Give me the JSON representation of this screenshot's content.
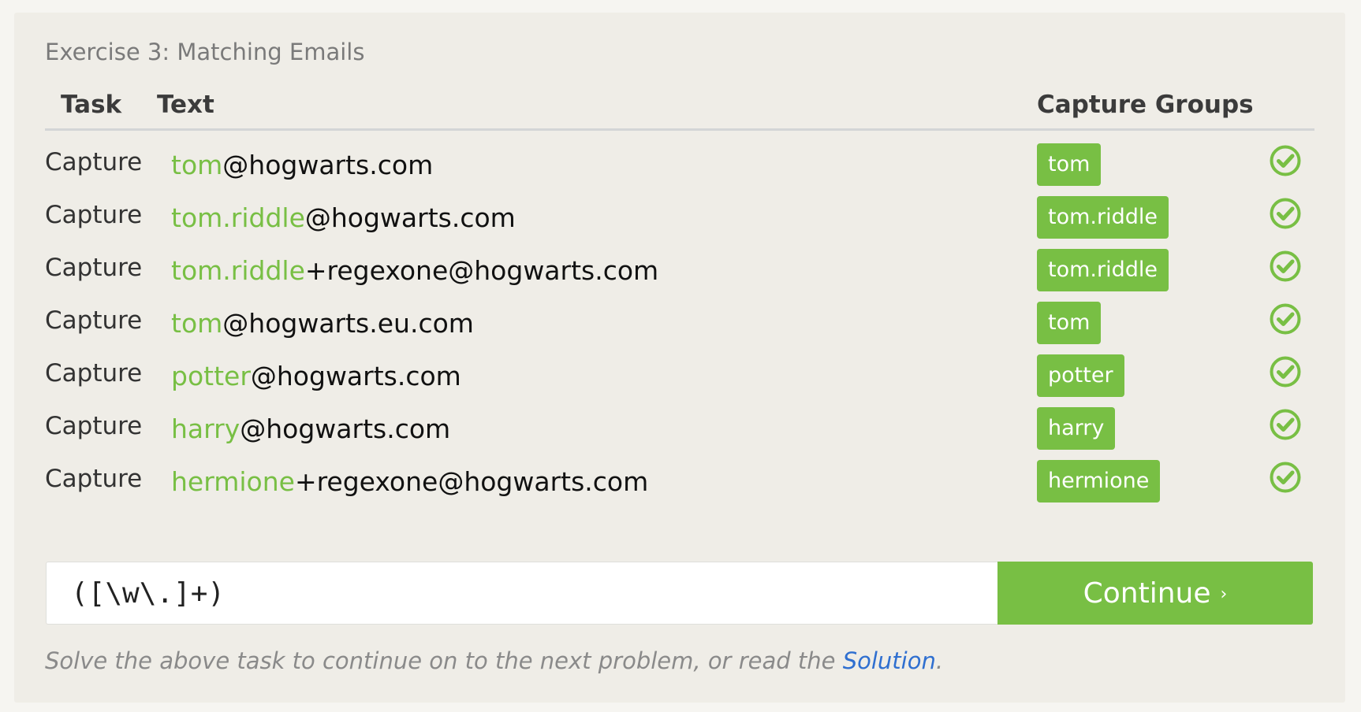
{
  "exercise": {
    "title": "Exercise 3: Matching Emails"
  },
  "columns": {
    "task": "Task",
    "text": "Text",
    "capture_groups": "Capture Groups"
  },
  "rows": [
    {
      "task": "Capture",
      "match": "tom",
      "rest": "@hogwarts.com",
      "group": "tom",
      "status": "check-circle-icon"
    },
    {
      "task": "Capture",
      "match": "tom.riddle",
      "rest": "@hogwarts.com",
      "group": "tom.riddle",
      "status": "check-circle-icon"
    },
    {
      "task": "Capture",
      "match": "tom.riddle",
      "rest": "+regexone@hogwarts.com",
      "group": "tom.riddle",
      "status": "check-circle-icon"
    },
    {
      "task": "Capture",
      "match": "tom",
      "rest": "@hogwarts.eu.com",
      "group": "tom",
      "status": "check-circle-icon"
    },
    {
      "task": "Capture",
      "match": "potter",
      "rest": "@hogwarts.com",
      "group": "potter",
      "status": "check-circle-icon"
    },
    {
      "task": "Capture",
      "match": "harry",
      "rest": "@hogwarts.com",
      "group": "harry",
      "status": "check-circle-icon"
    },
    {
      "task": "Capture",
      "match": "hermione",
      "rest": "+regexone@hogwarts.com",
      "group": "hermione",
      "status": "check-circle-icon"
    }
  ],
  "input": {
    "value": "([\\w\\.]+)"
  },
  "continue_button": {
    "label": "Continue",
    "chevron": "›"
  },
  "footer": {
    "before": "Solve the above task to continue on to the next problem, or read the ",
    "link": "Solution",
    "after": "."
  },
  "colors": {
    "accent_green": "#78bf44",
    "link_blue": "#2f6fd0",
    "panel_bg": "#efede7"
  }
}
